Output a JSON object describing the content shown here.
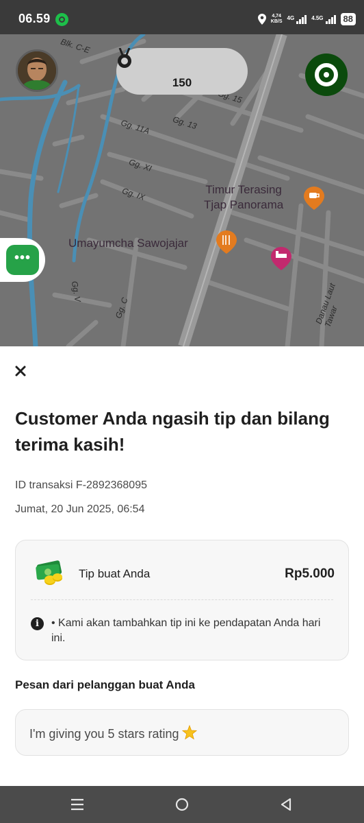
{
  "status_bar": {
    "time": "06.59",
    "net_speed_value": "4,74",
    "net_speed_unit": "KB/S",
    "sim1_label": "4G",
    "sim2_label": "4.5G",
    "battery": "88"
  },
  "map": {
    "street_labels": [
      "Blk. C-E",
      "Gg. 15",
      "Gg. 11A",
      "Gg. 13",
      "Gg. XI",
      "Gg. IX",
      "Gg. V",
      "Gg. C",
      "Danau Laut Tawar"
    ],
    "poi_1": {
      "line1": "Timur Terasing",
      "line2": "Tjap Panorama"
    },
    "poi_2": "Umayumcha Sawojajar",
    "medal_count": "150",
    "chat_button_glyph": "•••"
  },
  "sheet": {
    "title": "Customer Anda ngasih tip dan bilang terima kasih!",
    "transaction_id": "ID transaksi F-2892368095",
    "datetime": "Jumat, 20 Jun 2025, 06:54",
    "tip_card": {
      "label": "Tip buat Anda",
      "amount": "Rp5.000",
      "info_text": "• Kami akan tambahkan tip ini ke pendapatan Anda hari ini."
    },
    "message_heading": "Pesan dari pelanggan buat Anda",
    "message_text": "I'm giving you 5 stars rating"
  },
  "icons": {
    "close": "close-icon",
    "info": "info-icon",
    "money": "money-icon",
    "star": "star-icon",
    "medal": "medal-icon",
    "menu": "menu-icon",
    "home": "home-icon",
    "back": "back-icon"
  },
  "colors": {
    "brand_green": "#26a248",
    "brand_dark_green": "#0b4a0c",
    "map_bg": "#737373",
    "river": "#4a8fb5"
  }
}
